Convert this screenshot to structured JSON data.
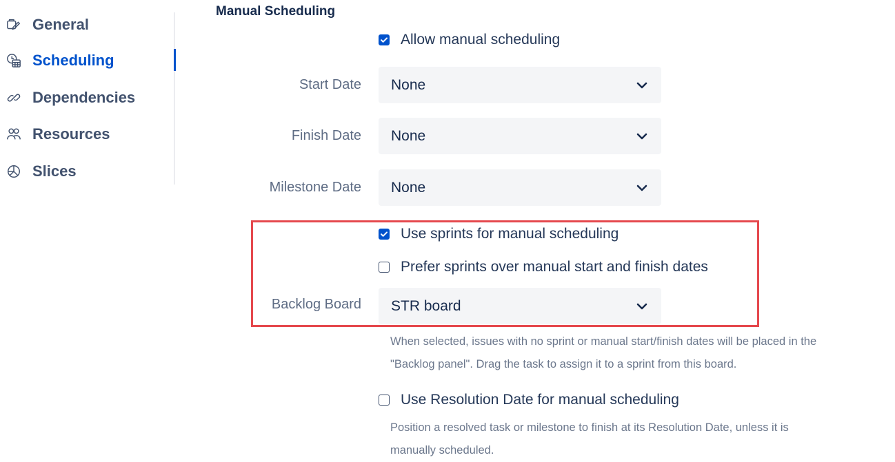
{
  "sidebar": {
    "items": [
      {
        "label": "General",
        "icon": "general-icon",
        "active": false
      },
      {
        "label": "Scheduling",
        "icon": "scheduling-icon",
        "active": true
      },
      {
        "label": "Dependencies",
        "icon": "link-icon",
        "active": false
      },
      {
        "label": "Resources",
        "icon": "resources-icon",
        "active": false
      },
      {
        "label": "Slices",
        "icon": "slices-icon",
        "active": false
      }
    ]
  },
  "main": {
    "section_title": "Manual Scheduling",
    "allow_manual": {
      "label": "Allow manual scheduling",
      "checked": true
    },
    "start_date": {
      "label": "Start Date",
      "value": "None"
    },
    "finish_date": {
      "label": "Finish Date",
      "value": "None"
    },
    "milestone_date": {
      "label": "Milestone Date",
      "value": "None"
    },
    "use_sprints": {
      "label": "Use sprints for manual scheduling",
      "checked": true
    },
    "prefer_sprints": {
      "label": "Prefer sprints over manual start and finish dates",
      "checked": false
    },
    "backlog_board": {
      "label": "Backlog Board",
      "value": "STR board"
    },
    "backlog_help": {
      "line1": "When selected, issues with no sprint or manual start/finish dates will be placed in the",
      "line2": "\"Backlog panel\". Drag the task to assign it to a sprint from this board."
    },
    "use_resolution": {
      "label": "Use Resolution Date for manual scheduling",
      "checked": false
    },
    "resolution_help": {
      "line1": "Position a resolved task or milestone to finish at its Resolution Date, unless it is",
      "line2": "manually scheduled."
    }
  },
  "colors": {
    "accent": "#0052cc",
    "highlight": "#e5484d",
    "select_bg": "#f4f5f7"
  }
}
